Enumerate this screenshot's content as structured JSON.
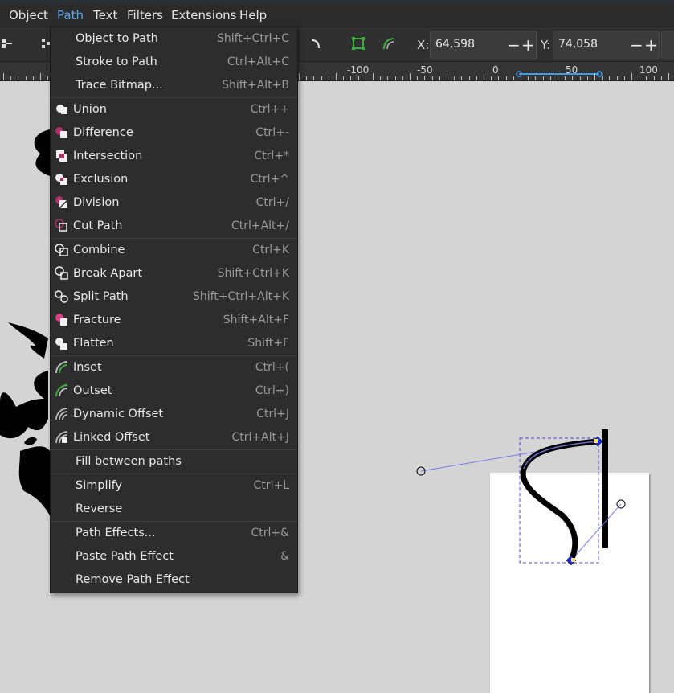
{
  "menubar": {
    "items": [
      "Object",
      "Path",
      "Text",
      "Filters",
      "Extensions",
      "Help"
    ],
    "active": "Path"
  },
  "toolbar": {
    "x_label": "X:",
    "x_value": "64,598",
    "y_label": "Y:",
    "y_value": "74,058",
    "minus": "−",
    "plus": "+"
  },
  "ruler": {
    "labels": [
      "-100",
      "-50",
      "0",
      "50",
      "100"
    ]
  },
  "path_menu": {
    "items": [
      {
        "label": "Object to Path",
        "shortcut": "Shift+Ctrl+C",
        "icon": "none"
      },
      {
        "label": "Stroke to Path",
        "shortcut": "Ctrl+Alt+C",
        "icon": "none"
      },
      {
        "label": "Trace Bitmap...",
        "shortcut": "Shift+Alt+B",
        "icon": "none"
      },
      {
        "label": "Union",
        "shortcut": "Ctrl++",
        "icon": "union-icon"
      },
      {
        "label": "Difference",
        "shortcut": "Ctrl+-",
        "icon": "difference-icon"
      },
      {
        "label": "Intersection",
        "shortcut": "Ctrl+*",
        "icon": "intersection-icon"
      },
      {
        "label": "Exclusion",
        "shortcut": "Ctrl+^",
        "icon": "exclusion-icon"
      },
      {
        "label": "Division",
        "shortcut": "Ctrl+/",
        "icon": "division-icon"
      },
      {
        "label": "Cut Path",
        "shortcut": "Ctrl+Alt+/",
        "icon": "cut-path-icon"
      },
      {
        "label": "Combine",
        "shortcut": "Ctrl+K",
        "icon": "combine-icon"
      },
      {
        "label": "Break Apart",
        "shortcut": "Shift+Ctrl+K",
        "icon": "break-apart-icon"
      },
      {
        "label": "Split Path",
        "shortcut": "Shift+Ctrl+Alt+K",
        "icon": "split-path-icon"
      },
      {
        "label": "Fracture",
        "shortcut": "Shift+Alt+F",
        "icon": "fracture-icon"
      },
      {
        "label": "Flatten",
        "shortcut": "Shift+F",
        "icon": "flatten-icon"
      },
      {
        "label": "Inset",
        "shortcut": "Ctrl+(",
        "icon": "inset-icon"
      },
      {
        "label": "Outset",
        "shortcut": "Ctrl+)",
        "icon": "outset-icon"
      },
      {
        "label": "Dynamic Offset",
        "shortcut": "Ctrl+J",
        "icon": "dynamic-offset-icon"
      },
      {
        "label": "Linked Offset",
        "shortcut": "Ctrl+Alt+J",
        "icon": "linked-offset-icon"
      },
      {
        "label": "Fill between paths",
        "shortcut": "",
        "icon": "none"
      },
      {
        "label": "Simplify",
        "shortcut": "Ctrl+L",
        "icon": "none"
      },
      {
        "label": "Reverse",
        "shortcut": "",
        "icon": "none"
      },
      {
        "label": "Path Effects...",
        "shortcut": "Ctrl+&",
        "icon": "none"
      },
      {
        "label": "Paste Path Effect",
        "shortcut": "&",
        "icon": "none"
      },
      {
        "label": "Remove Path Effect",
        "shortcut": "",
        "icon": "none"
      }
    ]
  },
  "colors": {
    "menu_bg": "#2d2d2d",
    "accent": "#5da7f0",
    "icon_magenta": "#b0306a",
    "icon_green": "#3fae3f",
    "node_handle": "#7a7af0"
  }
}
